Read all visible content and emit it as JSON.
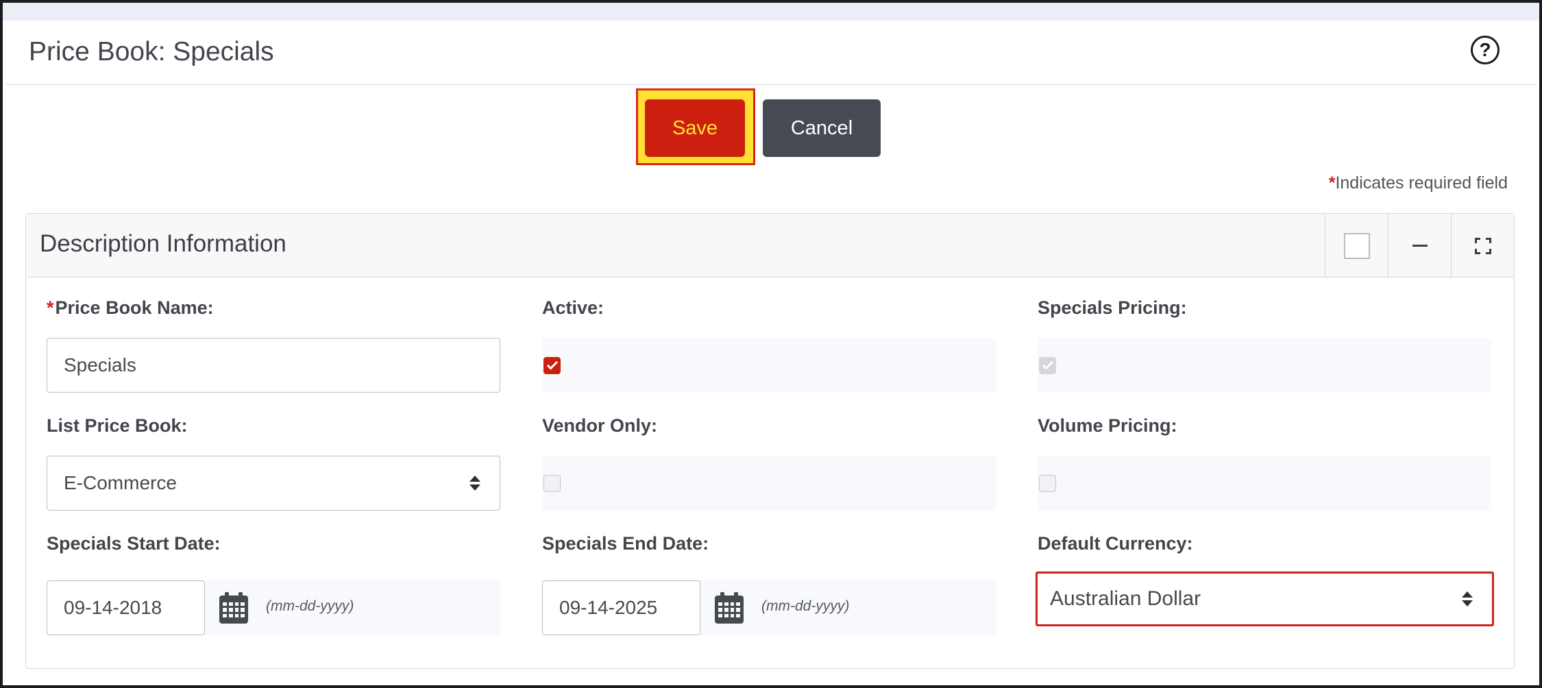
{
  "page": {
    "title": "Price Book: Specials",
    "help_icon_glyph": "?"
  },
  "toolbar": {
    "save_label": "Save",
    "cancel_label": "Cancel"
  },
  "required_note": {
    "star": "*",
    "text": "Indicates required field"
  },
  "panel": {
    "title": "Description Information",
    "tools": [
      "square-icon",
      "minus-icon",
      "expand-icon"
    ]
  },
  "fields": {
    "price_book_name": {
      "label": "Price Book Name:",
      "required_star": "*",
      "value": "Specials"
    },
    "active": {
      "label": "Active:",
      "checked": true
    },
    "specials_pricing": {
      "label": "Specials Pricing:",
      "checked": true,
      "disabled": true
    },
    "list_price_book": {
      "label": "List Price Book:",
      "value": "E-Commerce"
    },
    "vendor_only": {
      "label": "Vendor Only:",
      "checked": false
    },
    "volume_pricing": {
      "label": "Volume Pricing:",
      "checked": false
    },
    "specials_start_date": {
      "label": "Specials Start Date:",
      "value": "09-14-2018",
      "hint": "(mm-dd-yyyy)"
    },
    "specials_end_date": {
      "label": "Specials End Date:",
      "value": "09-14-2025",
      "hint": "(mm-dd-yyyy)"
    },
    "default_currency": {
      "label": "Default Currency:",
      "value": "Australian Dollar"
    }
  },
  "colors": {
    "accent_red": "#cc1f10",
    "highlight_yellow": "#ffe033",
    "cancel_gray": "#464a52"
  }
}
